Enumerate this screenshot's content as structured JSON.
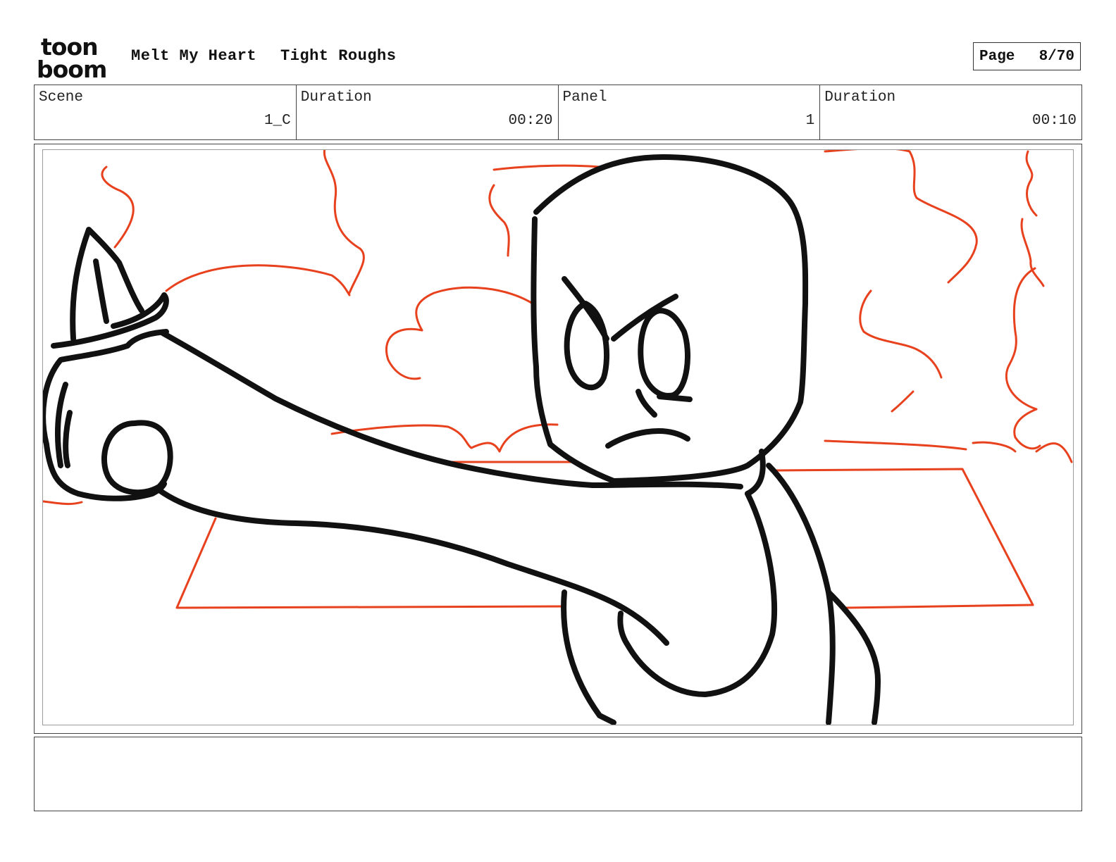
{
  "header": {
    "logo_line1": "toon",
    "logo_line2": "boom",
    "project_title": "Melt My Heart",
    "board_title": "Tight Roughs",
    "page_label": "Page",
    "page_value": "8/70"
  },
  "info": {
    "scene_label": "Scene",
    "scene_value": "1_C",
    "scene_duration_label": "Duration",
    "scene_duration_value": "00:20",
    "panel_label": "Panel",
    "panel_value": "1",
    "panel_duration_label": "Duration",
    "panel_duration_value": "00:10"
  },
  "colors": {
    "sketch_line": "#111111",
    "background_sketch": "#e8411e"
  }
}
